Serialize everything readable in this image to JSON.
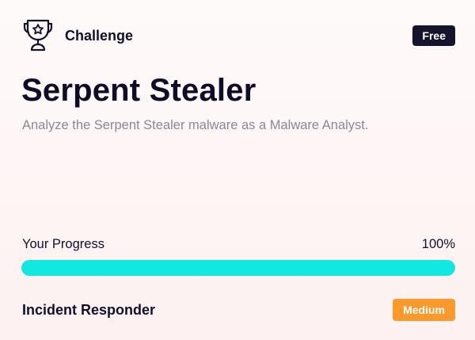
{
  "header": {
    "icon": "trophy-star-icon",
    "type_label": "Challenge",
    "price_badge": "Free"
  },
  "title": "Serpent Stealer",
  "description": "Analyze the Serpent Stealer malware as a Malware Analyst.",
  "progress": {
    "label": "Your Progress",
    "value_text": "100%",
    "value": 100
  },
  "footer": {
    "role": "Incident Responder",
    "difficulty": "Medium"
  },
  "colors": {
    "progress_fill": "#12e8df",
    "difficulty_badge": "#fb9a2c",
    "price_badge": "#16132e"
  }
}
